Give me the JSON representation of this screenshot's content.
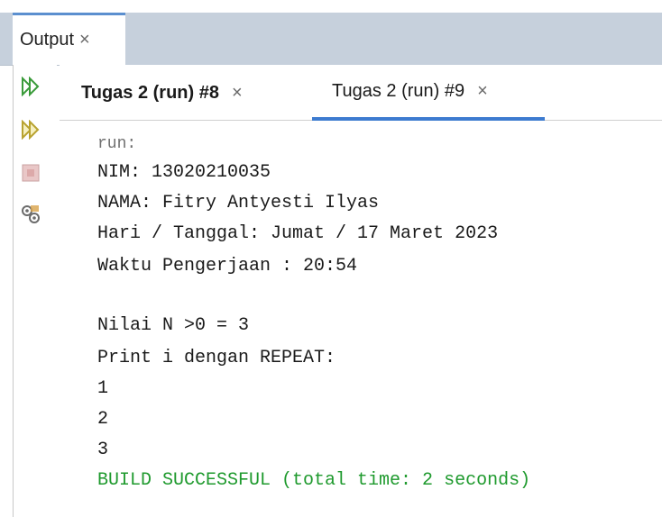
{
  "window": {
    "tab_label": "Output",
    "tab_close": "×"
  },
  "toolbar": {
    "icons": [
      "rerun-icon",
      "rerun-with-args-icon",
      "stop-icon",
      "settings-icon"
    ]
  },
  "tabs": [
    {
      "label": "Tugas 2 (run) #8",
      "close": "×",
      "active": false
    },
    {
      "label": "Tugas 2 (run) #9",
      "close": "×",
      "active": true
    }
  ],
  "console": {
    "lines": [
      "run:",
      "NIM: 13020210035",
      "NAMA: Fitry Antyesti Ilyas",
      "Hari / Tanggal: Jumat / 17 Maret 2023",
      "Waktu Pengerjaan : 20:54",
      "Nilai N >0 = 3",
      "Print i dengan REPEAT:",
      "1",
      "2",
      "3",
      "BUILD SUCCESSFUL (total time: 2 seconds)"
    ]
  },
  "colors": {
    "tabbar_bg": "#c6d0dc",
    "active_tab_underline": "#3d7bd0",
    "success_text": "#1f9a2e",
    "run_text": "#707070",
    "rerun_icon": "#2e8b2e"
  }
}
